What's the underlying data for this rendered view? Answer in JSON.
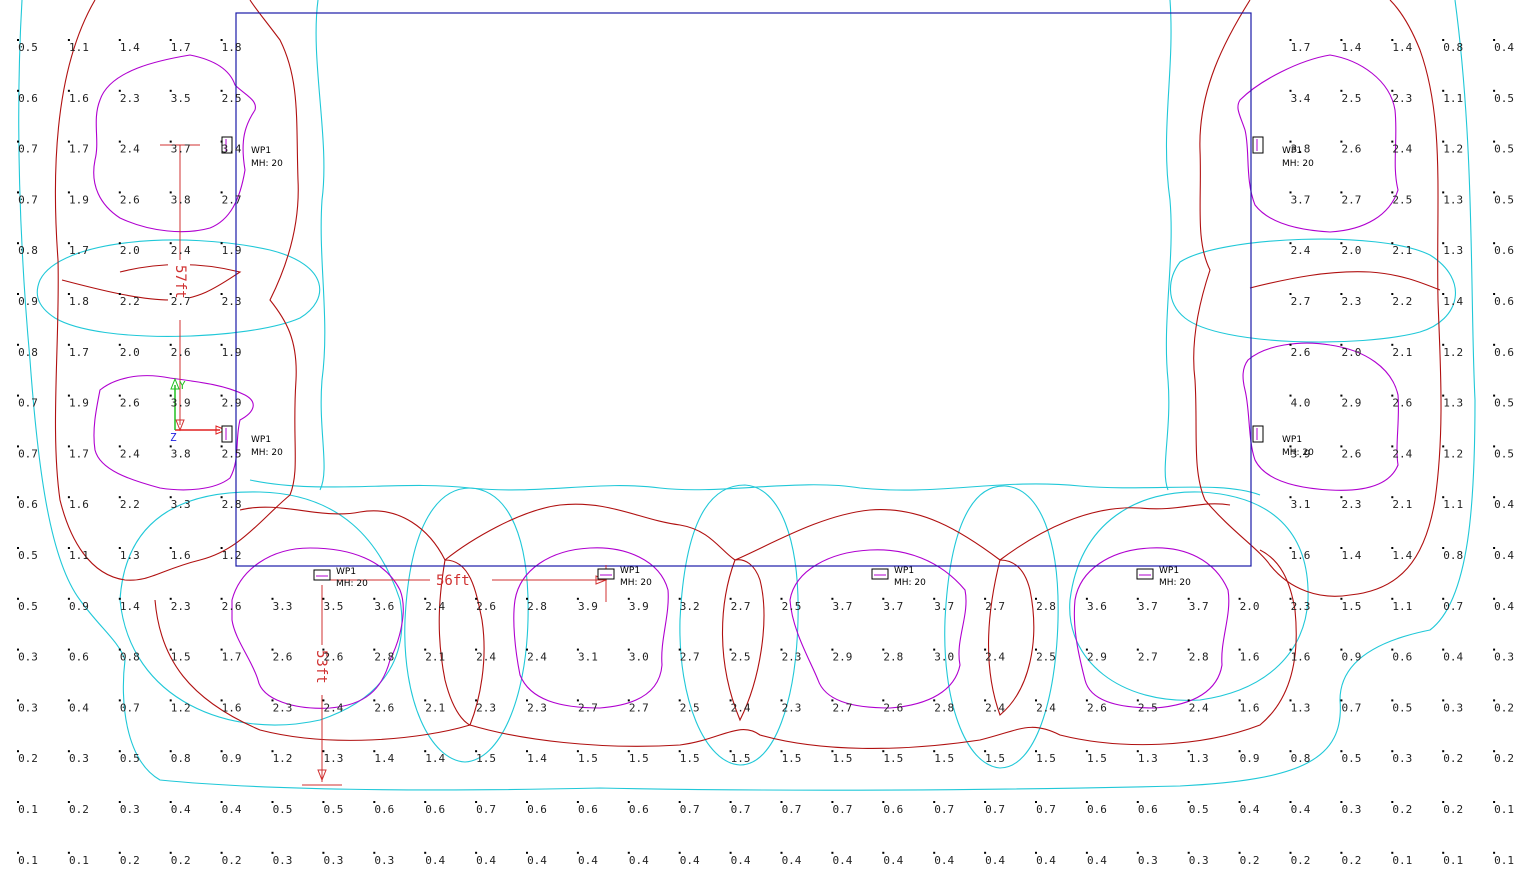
{
  "grid": {
    "rows": [
      [
        "0.5",
        "1.1",
        "1.4",
        "1.7",
        "1.8",
        null,
        null,
        null,
        null,
        null,
        null,
        null,
        null,
        null,
        null,
        null,
        null,
        null,
        null,
        null,
        null,
        null,
        null,
        null,
        null,
        "1.7",
        "1.4",
        "1.4",
        "0.8",
        "0.4"
      ],
      [
        "0.6",
        "1.6",
        "2.3",
        "3.5",
        "2.5",
        null,
        null,
        null,
        null,
        null,
        null,
        null,
        null,
        null,
        null,
        null,
        null,
        null,
        null,
        null,
        null,
        null,
        null,
        null,
        null,
        "3.4",
        "2.5",
        "2.3",
        "1.1",
        "0.5"
      ],
      [
        "0.7",
        "1.7",
        "2.4",
        "3.7",
        "3.4",
        null,
        null,
        null,
        null,
        null,
        null,
        null,
        null,
        null,
        null,
        null,
        null,
        null,
        null,
        null,
        null,
        null,
        null,
        null,
        null,
        "3.8",
        "2.6",
        "2.4",
        "1.2",
        "0.5"
      ],
      [
        "0.7",
        "1.9",
        "2.6",
        "3.8",
        "2.7",
        null,
        null,
        null,
        null,
        null,
        null,
        null,
        null,
        null,
        null,
        null,
        null,
        null,
        null,
        null,
        null,
        null,
        null,
        null,
        null,
        "3.7",
        "2.7",
        "2.5",
        "1.3",
        "0.5"
      ],
      [
        "0.8",
        "1.7",
        "2.0",
        "2.4",
        "1.9",
        null,
        null,
        null,
        null,
        null,
        null,
        null,
        null,
        null,
        null,
        null,
        null,
        null,
        null,
        null,
        null,
        null,
        null,
        null,
        null,
        "2.4",
        "2.0",
        "2.1",
        "1.3",
        "0.6"
      ],
      [
        "0.9",
        "1.8",
        "2.2",
        "2.7",
        "2.3",
        null,
        null,
        null,
        null,
        null,
        null,
        null,
        null,
        null,
        null,
        null,
        null,
        null,
        null,
        null,
        null,
        null,
        null,
        null,
        null,
        "2.7",
        "2.3",
        "2.2",
        "1.4",
        "0.6"
      ],
      [
        "0.8",
        "1.7",
        "2.0",
        "2.6",
        "1.9",
        null,
        null,
        null,
        null,
        null,
        null,
        null,
        null,
        null,
        null,
        null,
        null,
        null,
        null,
        null,
        null,
        null,
        null,
        null,
        null,
        "2.6",
        "2.0",
        "2.1",
        "1.2",
        "0.6"
      ],
      [
        "0.7",
        "1.9",
        "2.6",
        "3.9",
        "2.9",
        null,
        null,
        null,
        null,
        null,
        null,
        null,
        null,
        null,
        null,
        null,
        null,
        null,
        null,
        null,
        null,
        null,
        null,
        null,
        null,
        "4.0",
        "2.9",
        "2.6",
        "1.3",
        "0.5"
      ],
      [
        "0.7",
        "1.7",
        "2.4",
        "3.8",
        "2.5",
        null,
        null,
        null,
        null,
        null,
        null,
        null,
        null,
        null,
        null,
        null,
        null,
        null,
        null,
        null,
        null,
        null,
        null,
        null,
        null,
        "3.9",
        "2.6",
        "2.4",
        "1.2",
        "0.5"
      ],
      [
        "0.6",
        "1.6",
        "2.2",
        "3.3",
        "2.8",
        null,
        null,
        null,
        null,
        null,
        null,
        null,
        null,
        null,
        null,
        null,
        null,
        null,
        null,
        null,
        null,
        null,
        null,
        null,
        null,
        "3.1",
        "2.3",
        "2.1",
        "1.1",
        "0.4"
      ],
      [
        "0.5",
        "1.1",
        "1.3",
        "1.6",
        "1.2",
        null,
        null,
        null,
        null,
        null,
        null,
        null,
        null,
        null,
        null,
        null,
        null,
        null,
        null,
        null,
        null,
        null,
        null,
        null,
        null,
        "1.6",
        "1.4",
        "1.4",
        "0.8",
        "0.4"
      ],
      [
        "0.5",
        "0.9",
        "1.4",
        "2.3",
        "2.6",
        "3.3",
        "3.5",
        "3.6",
        "2.4",
        "2.6",
        "2.8",
        "3.9",
        "3.9",
        "3.2",
        "2.7",
        "2.5",
        "3.7",
        "3.7",
        "3.7",
        "2.7",
        "2.8",
        "3.6",
        "3.7",
        "3.7",
        "2.0",
        "2.3",
        "1.5",
        "1.1",
        "0.7",
        "0.4"
      ],
      [
        "0.3",
        "0.6",
        "0.8",
        "1.5",
        "1.7",
        "2.6",
        "2.6",
        "2.8",
        "2.1",
        "2.4",
        "2.4",
        "3.1",
        "3.0",
        "2.7",
        "2.5",
        "2.3",
        "2.9",
        "2.8",
        "3.0",
        "2.4",
        "2.5",
        "2.9",
        "2.7",
        "2.8",
        "1.6",
        "1.6",
        "0.9",
        "0.6",
        "0.4",
        "0.3"
      ],
      [
        "0.3",
        "0.4",
        "0.7",
        "1.2",
        "1.6",
        "2.3",
        "2.4",
        "2.6",
        "2.1",
        "2.3",
        "2.3",
        "2.7",
        "2.7",
        "2.5",
        "2.4",
        "2.3",
        "2.7",
        "2.6",
        "2.8",
        "2.4",
        "2.4",
        "2.6",
        "2.5",
        "2.4",
        "1.6",
        "1.3",
        "0.7",
        "0.5",
        "0.3",
        "0.2"
      ],
      [
        "0.2",
        "0.3",
        "0.5",
        "0.8",
        "0.9",
        "1.2",
        "1.3",
        "1.4",
        "1.4",
        "1.5",
        "1.4",
        "1.5",
        "1.5",
        "1.5",
        "1.5",
        "1.5",
        "1.5",
        "1.5",
        "1.5",
        "1.5",
        "1.5",
        "1.5",
        "1.3",
        "1.3",
        "0.9",
        "0.8",
        "0.5",
        "0.3",
        "0.2",
        "0.2"
      ],
      [
        "0.1",
        "0.2",
        "0.3",
        "0.4",
        "0.4",
        "0.5",
        "0.5",
        "0.6",
        "0.6",
        "0.7",
        "0.6",
        "0.6",
        "0.6",
        "0.7",
        "0.7",
        "0.7",
        "0.7",
        "0.6",
        "0.7",
        "0.7",
        "0.7",
        "0.6",
        "0.6",
        "0.5",
        "0.4",
        "0.4",
        "0.3",
        "0.2",
        "0.2",
        "0.1"
      ],
      [
        "0.1",
        "0.1",
        "0.2",
        "0.2",
        "0.2",
        "0.3",
        "0.3",
        "0.3",
        "0.4",
        "0.4",
        "0.4",
        "0.4",
        "0.4",
        "0.4",
        "0.4",
        "0.4",
        "0.4",
        "0.4",
        "0.4",
        "0.4",
        "0.4",
        "0.4",
        "0.3",
        "0.3",
        "0.2",
        "0.2",
        "0.2",
        "0.1",
        "0.1",
        "0.1"
      ]
    ]
  },
  "fixtures": [
    {
      "label": "WP1",
      "mh": "MH: 20"
    },
    {
      "label": "WP1",
      "mh": "MH: 20"
    },
    {
      "label": "WP1",
      "mh": "MH: 20"
    },
    {
      "label": "WP1",
      "mh": "MH: 20"
    },
    {
      "label": "WP1",
      "mh": "MH: 20"
    },
    {
      "label": "WP1",
      "mh": "MH: 20"
    },
    {
      "label": "WP1",
      "mh": "MH: 20"
    },
    {
      "label": "WP1",
      "mh": "MH: 20"
    }
  ],
  "dimensions": {
    "vertical_left": "57ft",
    "horizontal": "56ft",
    "vertical_bottom": "53ft"
  },
  "axis": {
    "y": "Y",
    "z": "Z"
  },
  "colors": {
    "building": "#1a1aa8",
    "contour_high": "#b000d0",
    "contour_mid": "#b01010",
    "contour_low": "#20c8d8",
    "dimension": "#d03030",
    "axis_x": "#e02020",
    "axis_y": "#20c020",
    "axis_z": "#2020e0"
  }
}
